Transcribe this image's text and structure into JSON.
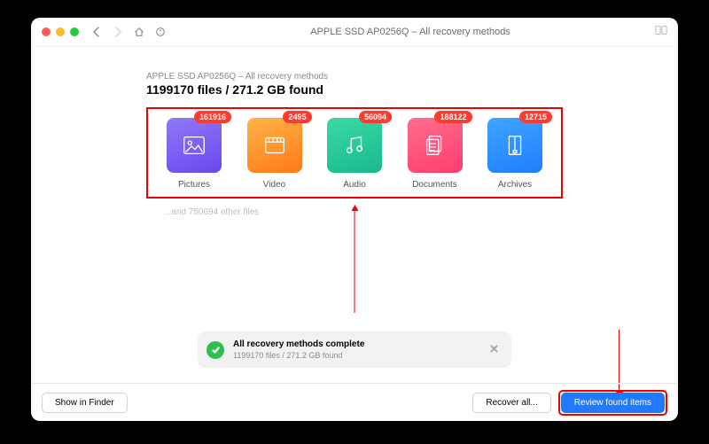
{
  "toolbar": {
    "title": "APPLE SSD AP0256Q – All recovery methods"
  },
  "header": {
    "breadcrumb": "APPLE SSD AP0256Q – All recovery methods",
    "summary": "1199170 files / 271.2 GB found"
  },
  "categories": [
    {
      "label": "Pictures",
      "count": "161916"
    },
    {
      "label": "Video",
      "count": "2495"
    },
    {
      "label": "Audio",
      "count": "56094"
    },
    {
      "label": "Documents",
      "count": "188122"
    },
    {
      "label": "Archives",
      "count": "12715"
    }
  ],
  "other_files_text": "...and 750694 other files",
  "status": {
    "title": "All recovery methods complete",
    "subtitle": "1199170 files / 271.2 GB found"
  },
  "buttons": {
    "show_in_finder": "Show in Finder",
    "recover_all": "Recover all...",
    "review": "Review found items"
  }
}
